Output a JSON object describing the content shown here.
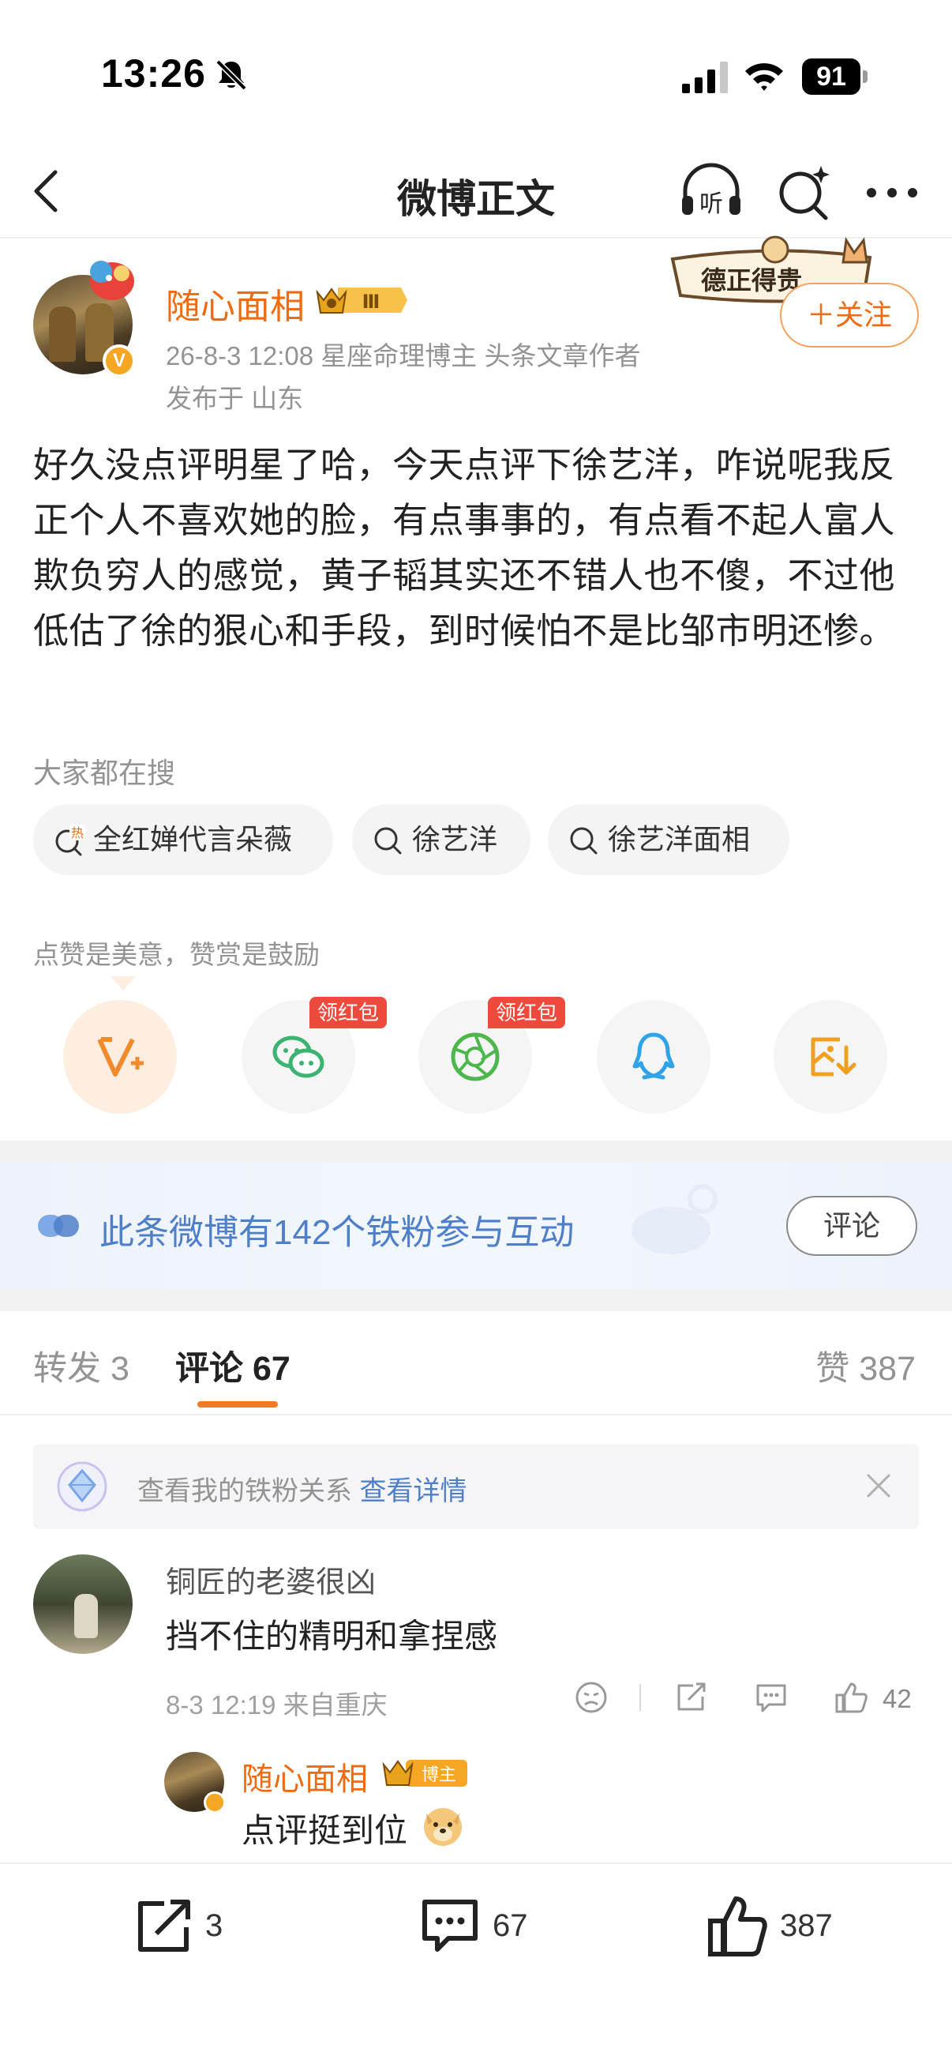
{
  "status_bar": {
    "time": "13:26",
    "battery": "91"
  },
  "nav": {
    "title": "微博正文",
    "listen_label": "听"
  },
  "post": {
    "author": "随心面相",
    "vip_level": "Ⅲ",
    "meta": "26-8-3 12:08  星座命理博主 头条文章作者",
    "location": "发布于 山东",
    "sticker_text": "德正得贵",
    "follow_label": "＋关注",
    "body": "好久没点评明星了哈，今天点评下徐艺洋，咋说呢我反正个人不喜欢她的脸，有点事事的，有点看不起人富人欺负穷人的感觉，黄子韬其实还不错人也不傻，不过他低估了徐的狠心和手段，到时候怕不是比邹市明还惨。"
  },
  "hot_search": {
    "title": "大家都在搜",
    "chips": [
      "全红婵代言朵薇",
      "徐艺洋",
      "徐艺洋面相"
    ],
    "hot_mark": "热"
  },
  "appreciation": {
    "caption": "点赞是美意，赞赏是鼓励",
    "red_packet_label": "领红包",
    "share_targets": [
      "v-reward-icon",
      "wechat-icon",
      "moments-icon",
      "qq-icon",
      "save-image-icon"
    ]
  },
  "fan_bar": {
    "text": "此条微博有142个铁粉参与互动",
    "button": "评论"
  },
  "tabs": {
    "repost": "转发 3",
    "comment": "评论 67",
    "like": "赞 387"
  },
  "relation_banner": {
    "text": "查看我的铁粉关系",
    "link": "查看详情"
  },
  "comment": {
    "user": "铜匠的老婆很凶",
    "text": "挡不住的精明和拿捏感",
    "meta": "8-3 12:19  来自重庆",
    "like_count": "42"
  },
  "reply": {
    "user": "随心面相",
    "badge": "博主",
    "text": "点评挺到位"
  },
  "bottom_bar": {
    "repost_count": "3",
    "comment_count": "67",
    "like_count": "387"
  },
  "colors": {
    "accent_orange": "#f06b10",
    "link_blue": "#4f7fc8",
    "red_tag": "#ee4a3c"
  }
}
